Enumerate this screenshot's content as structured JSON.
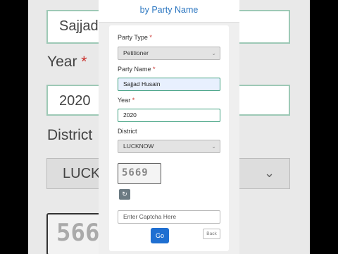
{
  "header": {
    "title": "by Party Name"
  },
  "form": {
    "party_type": {
      "label": "Party Type",
      "required_mark": "*",
      "value": "Petitioner"
    },
    "party_name": {
      "label": "Party Name",
      "required_mark": "*",
      "value": "Sajjad Husain"
    },
    "year": {
      "label": "Year",
      "required_mark": "*",
      "value": "2020"
    },
    "district": {
      "label": "District",
      "value": "LUCKNOW"
    },
    "captcha": {
      "code": "5669",
      "placeholder": "Enter Captcha Here"
    },
    "go_label": "Go",
    "back_label": "Back"
  },
  "background": {
    "name_fragment": "Sajjad",
    "year_label": "Year",
    "year_value": "2020",
    "district_label": "District",
    "district_value": "LUCKNOW",
    "captcha_fragment": "566"
  },
  "icons": {
    "refresh": "refresh-icon",
    "chevron": "chevron-down-icon"
  },
  "colors": {
    "title": "#2b76c0",
    "go_button": "#1f6fd1",
    "focus_border": "#3fa07f",
    "required": "#c9302c"
  }
}
